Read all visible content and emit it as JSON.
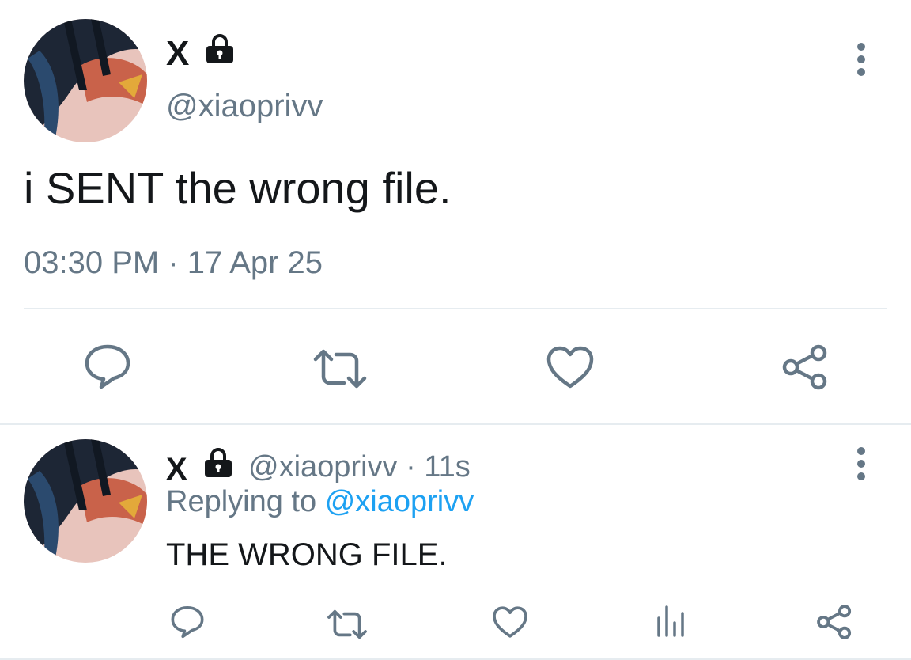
{
  "main_tweet": {
    "display_name": "X",
    "handle": "@xiaoprivv",
    "text": "i SENT the wrong file.",
    "time": "03:30 PM",
    "separator": "·",
    "date": "17 Apr 25",
    "actions": [
      "reply-icon",
      "retweet-icon",
      "like-icon",
      "share-icon"
    ],
    "more_icon": "more-vertical-icon",
    "locked_icon": "lock-icon"
  },
  "reply_tweet": {
    "display_name": "X",
    "handle": "@xiaoprivv",
    "separator": "·",
    "age": "11s",
    "replying_prefix": "Replying to",
    "replying_handle": "@xiaoprivv",
    "text": "THE WRONG FILE.",
    "actions": [
      "reply-icon",
      "retweet-icon",
      "like-icon",
      "analytics-icon",
      "share-icon"
    ],
    "more_icon": "more-vertical-icon",
    "locked_icon": "lock-icon"
  },
  "colors": {
    "text": "#14171a",
    "muted": "#657786",
    "link": "#1da1f2",
    "divider": "#e6ecf0"
  }
}
